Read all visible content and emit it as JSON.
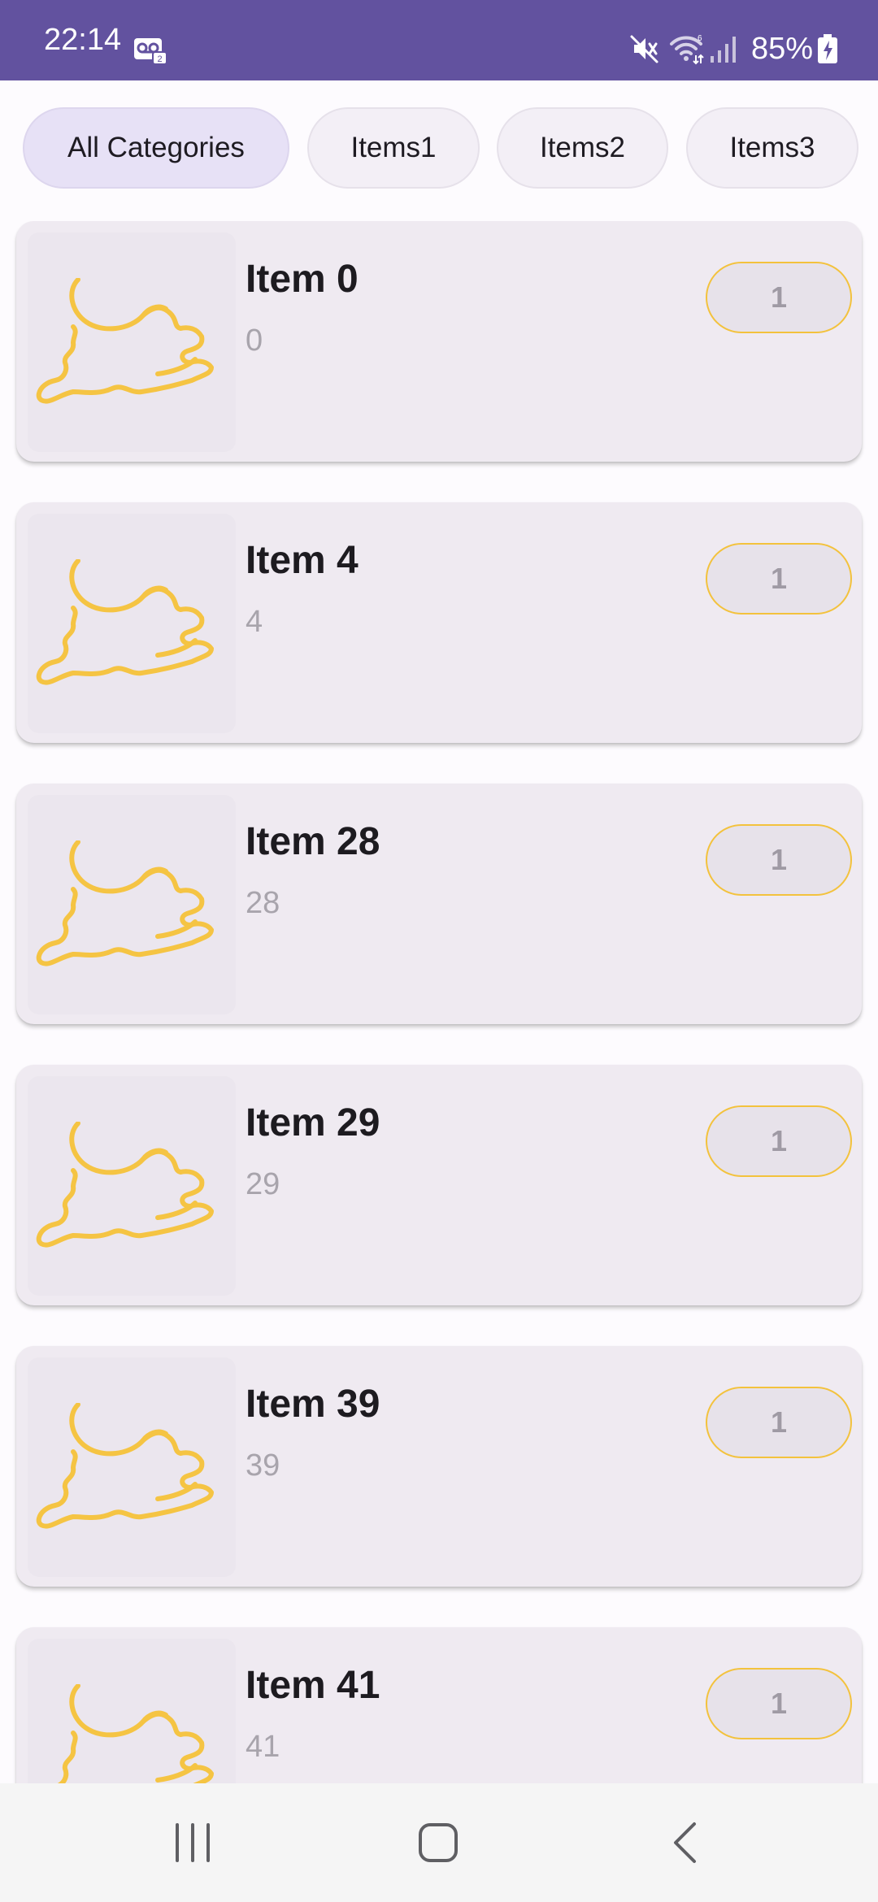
{
  "status_bar": {
    "time": "22:14",
    "battery": "85%",
    "icons": [
      "voicemail-icon",
      "mute-icon",
      "wifi-icon",
      "signal-icon",
      "battery-charging-icon"
    ]
  },
  "categories": [
    {
      "label": "All Categories",
      "selected": true
    },
    {
      "label": "Items1",
      "selected": false
    },
    {
      "label": "Items2",
      "selected": false
    },
    {
      "label": "Items3",
      "selected": false
    }
  ],
  "items": [
    {
      "title": "Item 0",
      "subtitle": "0",
      "quantity": "1",
      "image": "running-dog-icon"
    },
    {
      "title": "Item 4",
      "subtitle": "4",
      "quantity": "1",
      "image": "running-dog-icon"
    },
    {
      "title": "Item 28",
      "subtitle": "28",
      "quantity": "1",
      "image": "running-dog-icon"
    },
    {
      "title": "Item 29",
      "subtitle": "29",
      "quantity": "1",
      "image": "running-dog-icon"
    },
    {
      "title": "Item 39",
      "subtitle": "39",
      "quantity": "1",
      "image": "running-dog-icon"
    },
    {
      "title": "Item 41",
      "subtitle": "41",
      "quantity": "1",
      "image": "running-dog-icon"
    }
  ],
  "nav_bar": {
    "buttons": [
      "recents-icon",
      "home-icon",
      "back-icon"
    ]
  },
  "colors": {
    "status_bar": "#62529f",
    "accent_yellow": "#f3c23d",
    "card_background": "#efeaf1",
    "chip_selected": "#e7e1f6"
  }
}
